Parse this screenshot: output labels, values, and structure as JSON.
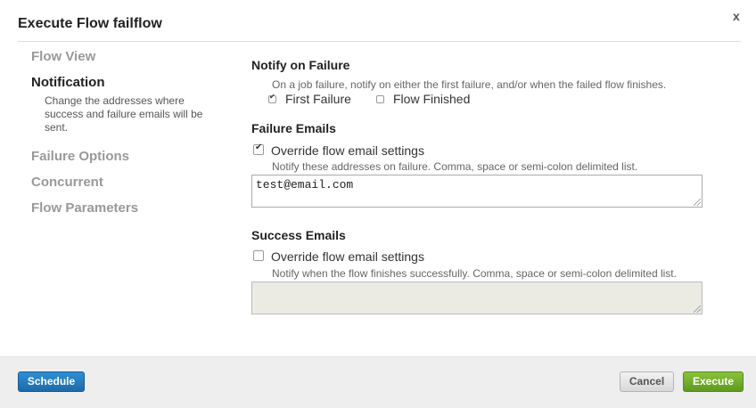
{
  "dialog": {
    "title": "Execute Flow failflow",
    "close_label": "x"
  },
  "nav": {
    "items": [
      {
        "label": "Flow View"
      },
      {
        "label": "Notification",
        "active": true,
        "description": "Change the addresses where success and failure emails will be sent."
      },
      {
        "label": "Failure Options"
      },
      {
        "label": "Concurrent"
      },
      {
        "label": "Flow Parameters"
      }
    ]
  },
  "notify_on_failure": {
    "title": "Notify on Failure",
    "help": "On a job failure, notify on either the first failure, and/or when the failed flow finishes.",
    "first_failure": {
      "label": "First Failure",
      "checked": true
    },
    "flow_finished": {
      "label": "Flow Finished",
      "checked": false
    }
  },
  "failure_emails": {
    "title": "Failure Emails",
    "override": {
      "label": "Override flow email settings",
      "checked": true
    },
    "help": "Notify these addresses on failure. Comma, space or semi-colon delimited list.",
    "value": "test@email.com"
  },
  "success_emails": {
    "title": "Success Emails",
    "override": {
      "label": "Override flow email settings",
      "checked": false
    },
    "help": "Notify when the flow finishes successfully. Comma, space or semi-colon delimited list.",
    "value": "",
    "disabled": true
  },
  "footer": {
    "schedule_label": "Schedule",
    "cancel_label": "Cancel",
    "execute_label": "Execute"
  },
  "colors": {
    "schedule": "#1e6aa8",
    "execute": "#6ea82a",
    "cancel": "#d8d8d8",
    "footer_bg": "#eeeeee"
  }
}
